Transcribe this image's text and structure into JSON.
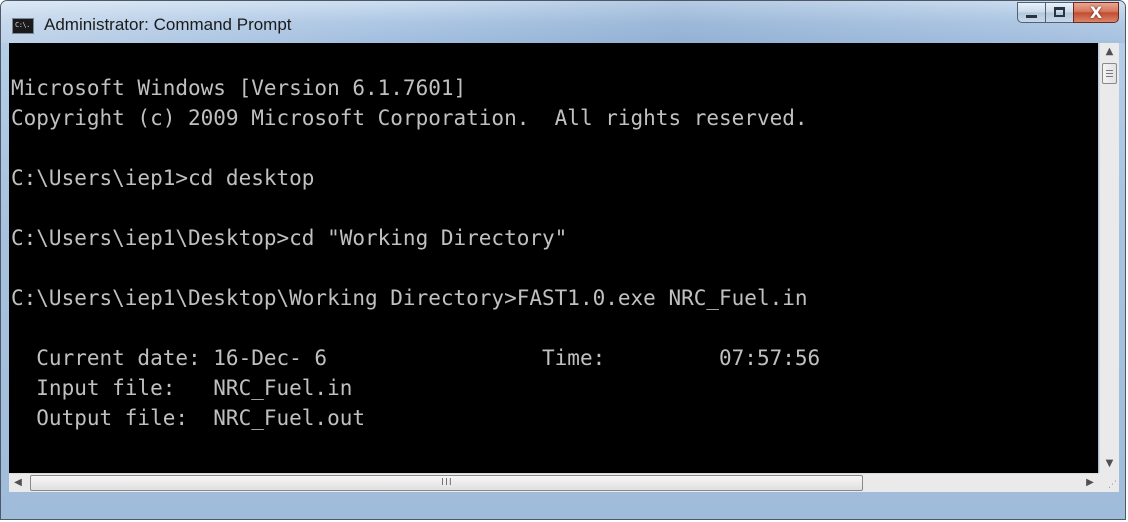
{
  "window": {
    "title": "Administrator: Command Prompt",
    "icon_label": "C:\\.",
    "buttons": {
      "minimize": "minimize-icon",
      "maximize": "maximize-icon",
      "close": "X"
    }
  },
  "console": {
    "background": "#000000",
    "foreground": "#c0c0c0",
    "lines": [
      "Microsoft Windows [Version 6.1.7601]",
      "Copyright (c) 2009 Microsoft Corporation.  All rights reserved.",
      "",
      "C:\\Users\\iep1>cd desktop",
      "",
      "C:\\Users\\iep1\\Desktop>cd \"Working Directory\"",
      "",
      "C:\\Users\\iep1\\Desktop\\Working Directory>FAST1.0.exe NRC_Fuel.in",
      "",
      "  Current date: 16-Dec- 6                 Time:         07:57:56",
      "  Input file:   NRC_Fuel.in",
      "  Output file:  NRC_Fuel.out"
    ]
  },
  "scrollbars": {
    "horizontal_thumb_glyph": "III",
    "size_grip_glyph": "⋰"
  }
}
